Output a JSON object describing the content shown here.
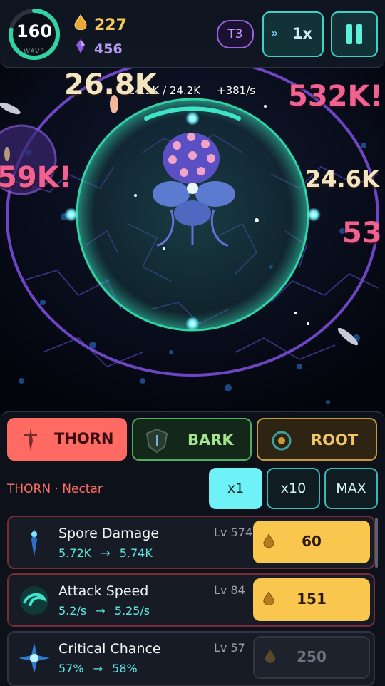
{
  "hud": {
    "wave_number": "160",
    "wave_label": "WAVE",
    "wave_progress": 0.78,
    "nectar": "227",
    "gems": "456",
    "tier": "T3",
    "speed_arrows": "»",
    "speed": "1x"
  },
  "arena": {
    "hp": "24.2K / 24.2K",
    "regen": "+381/s",
    "damage_popups": [
      {
        "text": "26.8K"
      },
      {
        "text": "532K!"
      },
      {
        "text": "59K!"
      },
      {
        "text": "24.6K"
      },
      {
        "text": "53"
      }
    ]
  },
  "panel": {
    "tabs": [
      {
        "label": "THORN"
      },
      {
        "label": "BARK"
      },
      {
        "label": "ROOT"
      }
    ],
    "section_label": "THORN · Nectar",
    "multipliers": [
      "x1",
      "x10",
      "MAX"
    ],
    "upgrades": [
      {
        "name": "Spore Damage",
        "level": "Lv 574",
        "from": "5.72K",
        "to": "5.74K",
        "cost": "60",
        "affordable": true
      },
      {
        "name": "Attack Speed",
        "level": "Lv 84",
        "from": "5.2/s",
        "to": "5.25/s",
        "cost": "151",
        "affordable": true
      },
      {
        "name": "Critical Chance",
        "level": "Lv 57",
        "from": "57%",
        "to": "58%",
        "cost": "250",
        "affordable": false
      }
    ],
    "arrow": "→"
  },
  "colors": {
    "accent_teal": "#3fd0c8",
    "thorn": "#ff6a62",
    "bark": "#4fae60",
    "root": "#c79a3e",
    "gold": "#f9c64e",
    "damage_pink": "#f06292",
    "damage_cream": "#f3e4c2"
  }
}
